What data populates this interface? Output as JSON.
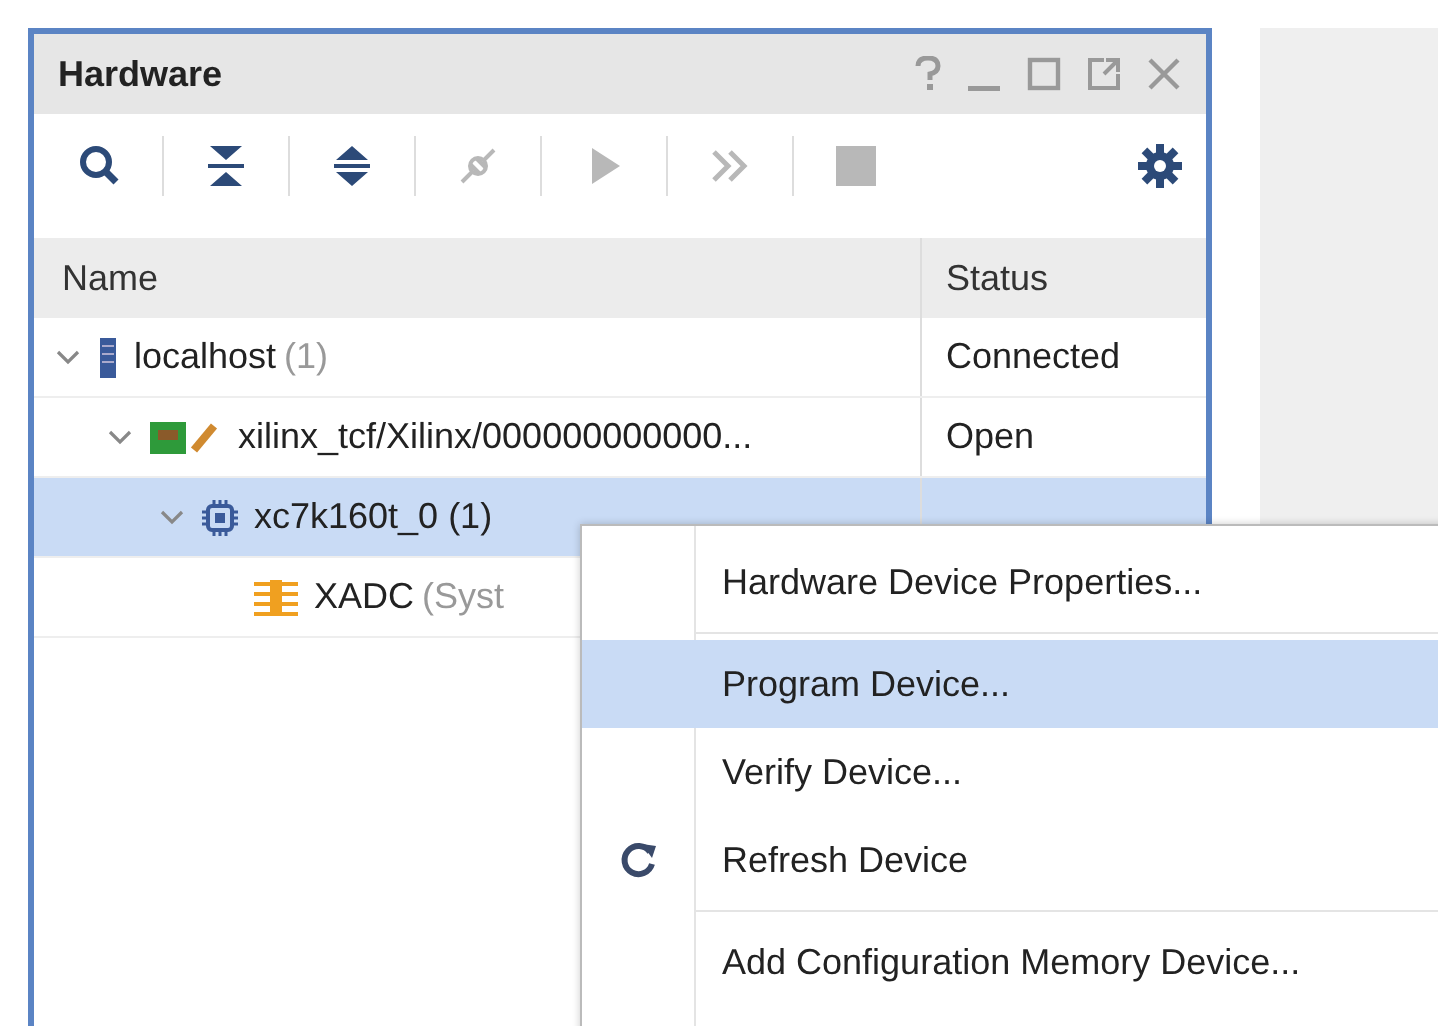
{
  "window": {
    "title": "Hardware"
  },
  "toolbar": [
    {
      "kind": "search",
      "disabled": false
    },
    {
      "kind": "collapse",
      "disabled": false
    },
    {
      "kind": "expand",
      "disabled": false
    },
    {
      "kind": "connect",
      "disabled": true
    },
    {
      "kind": "run",
      "disabled": true
    },
    {
      "kind": "step",
      "disabled": true
    },
    {
      "kind": "stop",
      "disabled": true
    },
    {
      "kind": "settings",
      "disabled": false
    }
  ],
  "table": {
    "columns": [
      "Name",
      "Status"
    ],
    "rows": [
      {
        "kind": "server",
        "name": "localhost",
        "count": "(1)",
        "status": "Connected",
        "expanded": true,
        "selected": false,
        "children": [
          {
            "kind": "cable",
            "name": "xilinx_tcf/Xilinx/000000000000...",
            "status": "Open",
            "expanded": true,
            "selected": false,
            "children": [
              {
                "kind": "chip",
                "name": "xc7k160t_0 (1)",
                "expanded": true,
                "selected": true,
                "children": [
                  {
                    "kind": "xadc",
                    "name": "XADC",
                    "count": "(Syst",
                    "selected": false
                  }
                ]
              }
            ]
          }
        ]
      }
    ]
  },
  "context_menu": [
    {
      "kind": "item",
      "label": "Hardware Device Properties...",
      "selected": false
    },
    {
      "kind": "separator"
    },
    {
      "kind": "item",
      "label": "Program Device...",
      "selected": true
    },
    {
      "kind": "item",
      "label": "Verify Device...",
      "selected": false
    },
    {
      "kind": "refresh",
      "label": "Refresh Device",
      "selected": false
    },
    {
      "kind": "separator"
    },
    {
      "kind": "item",
      "label": "Add Configuration Memory Device...",
      "selected": false
    }
  ]
}
